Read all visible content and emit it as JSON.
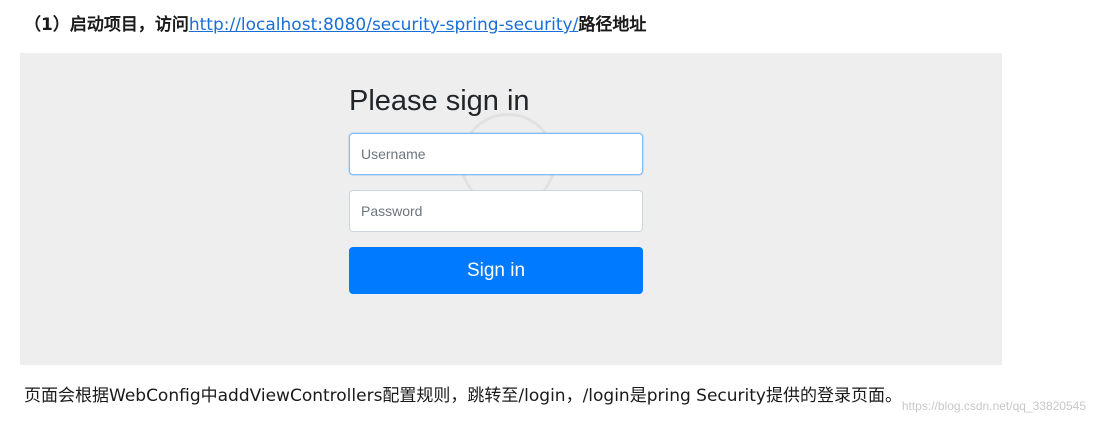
{
  "heading": {
    "prefix": "（1）启动项目，访问",
    "link_text": "http://localhost:8080/security-spring-security/",
    "suffix": "路径地址"
  },
  "login_form": {
    "title": "Please sign in",
    "username_placeholder": "Username",
    "password_placeholder": "Password",
    "submit_label": "Sign in"
  },
  "caption": "页面会根据WebConfig中addViewControllers配置规则，跳转至/login，/login是pring Security提供的登录页面。",
  "watermark": "https://blog.csdn.net/qq_33820545",
  "colors": {
    "accent": "#007bff",
    "panel_background": "#eeeeee",
    "link": "#1a6fd6"
  }
}
